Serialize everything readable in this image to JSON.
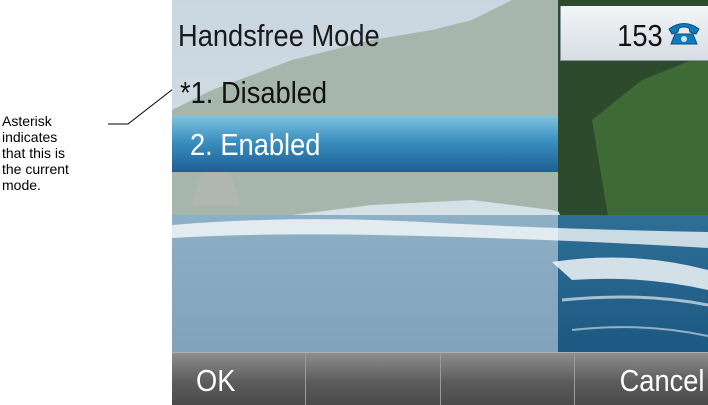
{
  "annotation": {
    "lines": [
      "Asterisk",
      "indicates",
      "that this is",
      "the current",
      "mode."
    ]
  },
  "screen": {
    "title": "Handsfree Mode",
    "extension": "153",
    "status_icon": "phone-handset-icon",
    "items": [
      {
        "label": "*1.  Disabled",
        "selected": false
      },
      {
        "label": "2.  Enabled",
        "selected": true
      }
    ],
    "softkeys": [
      "OK",
      "",
      "",
      "Cancel"
    ],
    "colors": {
      "highlight": "#2a74ad",
      "softkey_bar": "#5c5c5c",
      "phone_icon": "#0e7bbd"
    }
  }
}
